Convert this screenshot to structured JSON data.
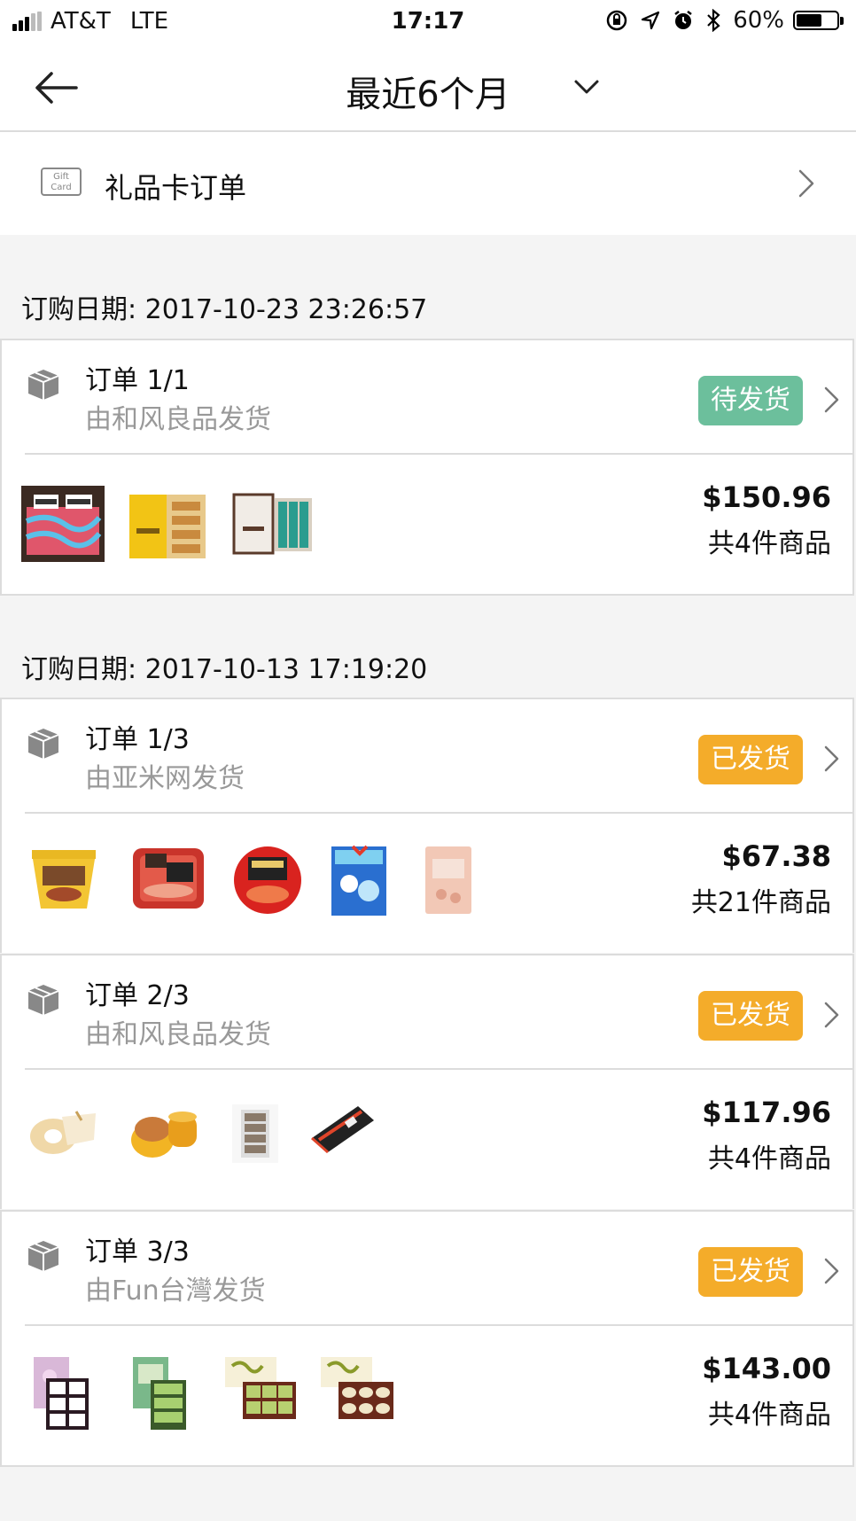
{
  "status_bar": {
    "carrier": "AT&T",
    "network": "LTE",
    "time": "17:17",
    "battery_percent": "60%",
    "battery_level": 0.6,
    "icons": [
      "rotation-lock-icon",
      "location-icon",
      "alarm-icon",
      "bluetooth-icon"
    ]
  },
  "nav": {
    "title": "最近6个月",
    "back_icon": "back-arrow-icon",
    "dropdown_icon": "chevron-down-icon"
  },
  "gift_card": {
    "icon_text_line1": "Gift",
    "icon_text_line2": "Card",
    "label": "礼品卡订单"
  },
  "groups": [
    {
      "date_label": "订购日期: 2017-10-23 23:26:57",
      "orders": [
        {
          "title": "订单 1/1",
          "shipper": "由和风良品发货",
          "status": "待发货",
          "status_color": "#6cbf9c",
          "price": "$150.96",
          "count": "共4件商品",
          "thumbnails": [
            "cheesecake-box",
            "yellow-snack-box",
            "teal-snack-box"
          ]
        }
      ]
    },
    {
      "date_label": "订购日期: 2017-10-13 17:19:20",
      "orders": [
        {
          "title": "订单 1/3",
          "shipper": "由亚米网发货",
          "status": "已发货",
          "status_color": "#f4ac2a",
          "price": "$67.38",
          "count": "共21件商品",
          "thumbnails": [
            "noodle-cup",
            "hotpot-tray",
            "noodle-bowl",
            "candy-bag",
            "snack-bag"
          ]
        },
        {
          "title": "订单 2/3",
          "shipper": "由和风良品发货",
          "status": "已发货",
          "status_color": "#f4ac2a",
          "price": "$117.96",
          "count": "共4件商品",
          "thumbnails": [
            "baumkuchen-cake",
            "cookie-tin",
            "cracker-box",
            "black-gift-box"
          ]
        },
        {
          "title": "订单 3/3",
          "shipper": "由Fun台灣发货",
          "status": "已发货",
          "status_color": "#f4ac2a",
          "price": "$143.00",
          "count": "共4件商品",
          "thumbnails": [
            "purple-pastry-box",
            "green-pastry-box",
            "pineapple-cake-box",
            "yolk-pastry-box"
          ]
        }
      ]
    }
  ]
}
